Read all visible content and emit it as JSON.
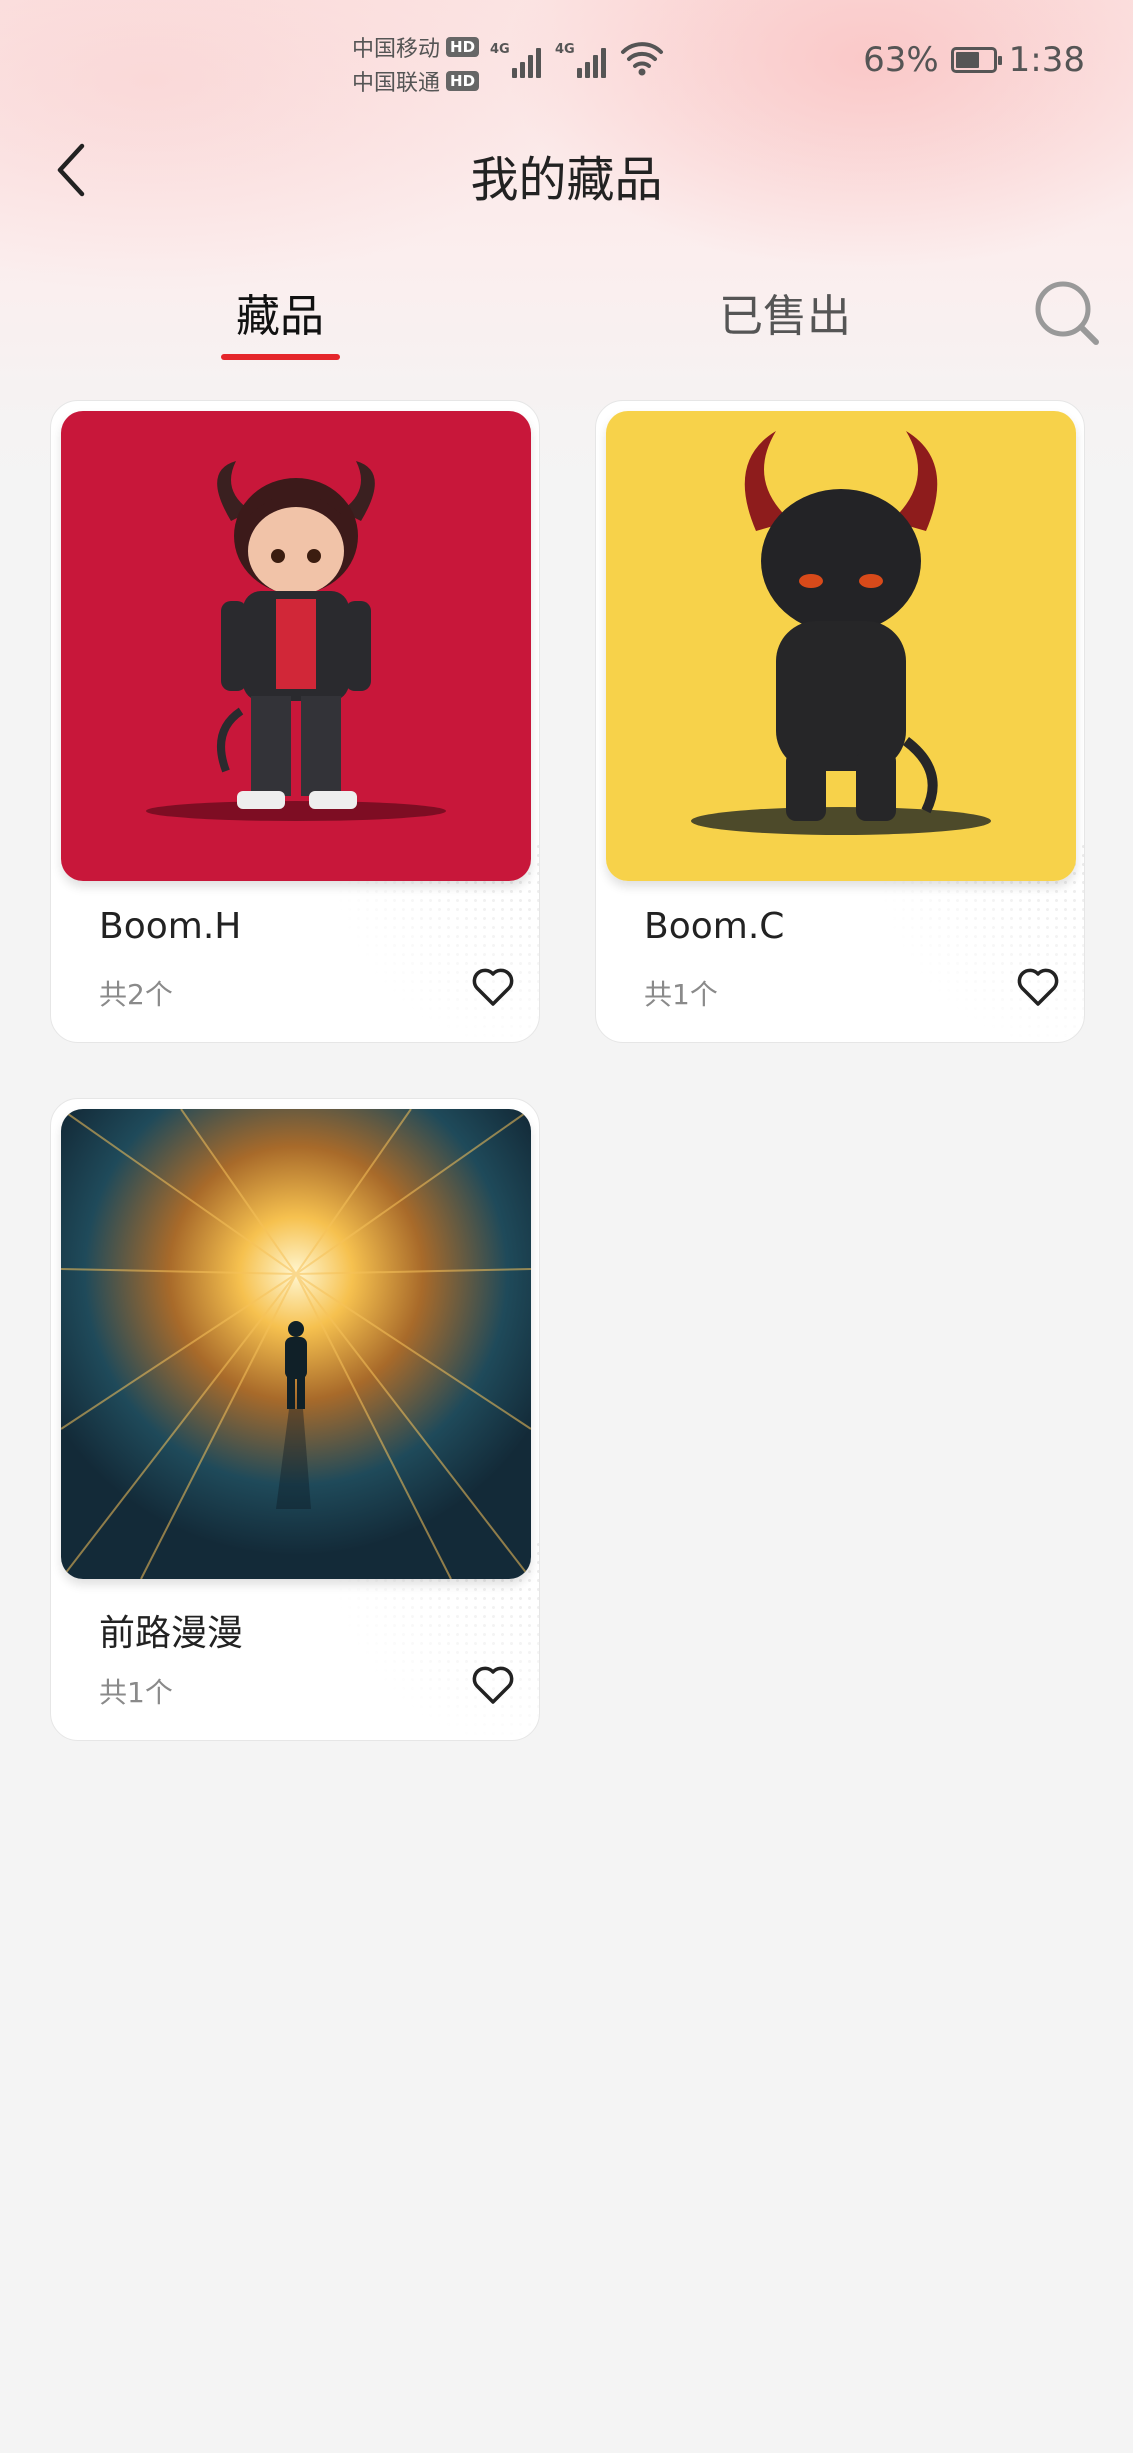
{
  "status_bar": {
    "carrier_1": "中国移动",
    "carrier_2": "中国联通",
    "hd_label": "HD",
    "network_label": "4G",
    "battery_percent": "63%",
    "battery_level": 0.63,
    "time": "1:38"
  },
  "header": {
    "title": "我的藏品",
    "back_icon": "chevron-left-icon"
  },
  "tabs": [
    {
      "label": "藏品",
      "active": true
    },
    {
      "label": "已售出",
      "active": false
    }
  ],
  "search_icon": "search-icon",
  "colors": {
    "accent": "#e5262b",
    "card1_bg": "#c8173a",
    "card2_bg": "#f7d24a",
    "card3_bg": "#1c3a4a"
  },
  "items": [
    {
      "name": "Boom.H",
      "count": "共2个",
      "image": "red-horned-character-image",
      "favorite_icon": "heart-outline-icon"
    },
    {
      "name": "Boom.C",
      "count": "共1个",
      "image": "black-horned-creature-image",
      "favorite_icon": "heart-outline-icon"
    },
    {
      "name": "前路漫漫",
      "count": "共1个",
      "image": "light-tunnel-figure-image",
      "favorite_icon": "heart-outline-icon"
    }
  ]
}
